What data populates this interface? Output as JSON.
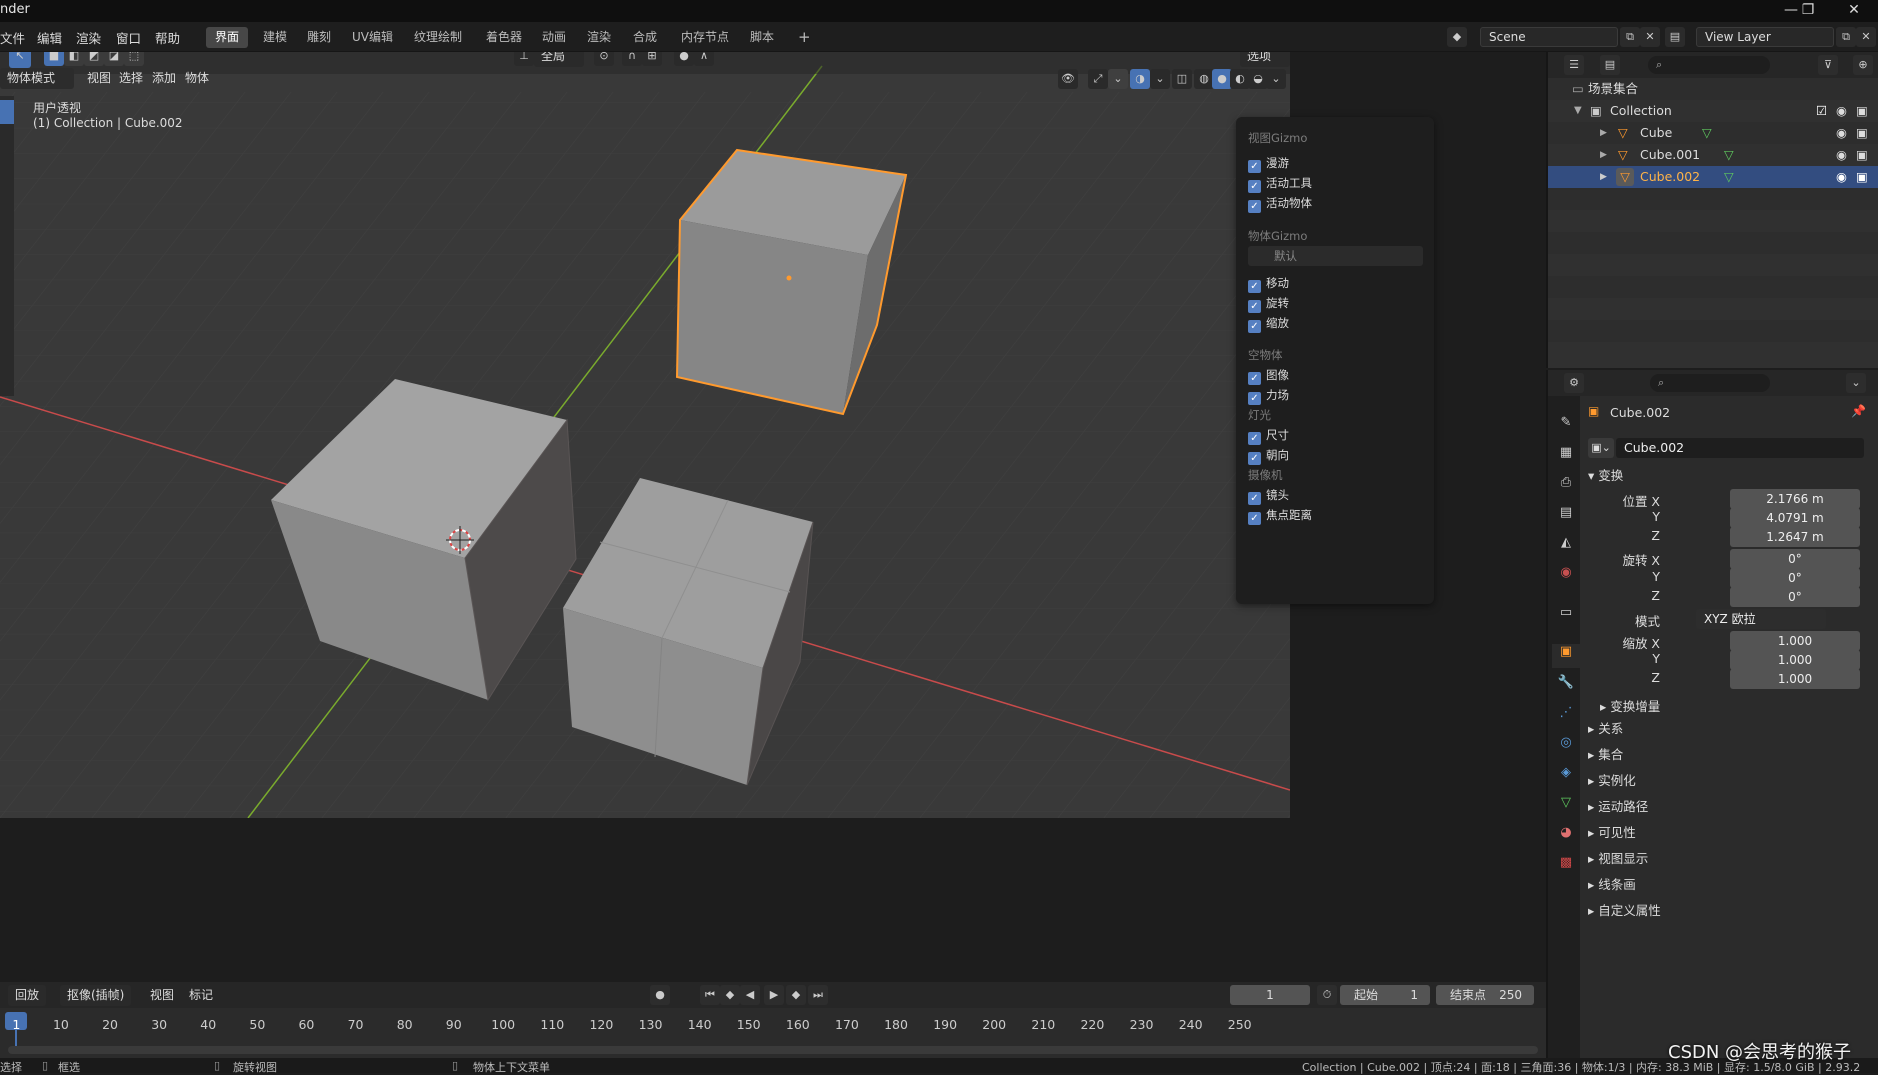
{
  "titlebar": {
    "title": "nder",
    "min_icon": "—",
    "max_icon": "❐",
    "close_icon": "✕"
  },
  "menubar": [
    "文件",
    "编辑",
    "渲染",
    "窗口",
    "帮助"
  ],
  "workspaces": [
    "界面",
    "建模",
    "雕刻",
    "UV编辑",
    "纹理绘制",
    "着色器",
    "动画",
    "渲染",
    "合成",
    "内存节点",
    "脚本"
  ],
  "add_workspace": "+",
  "scene_field": "Scene",
  "view_layer_field": "View Layer",
  "tool_header": {
    "transform_orient": "全局",
    "options": "选项 ⌄"
  },
  "viewport_header": {
    "mode": "物体模式",
    "menus": [
      "视图",
      "选择",
      "添加",
      "物体"
    ]
  },
  "viewport_overlay": {
    "line1": "用户透视",
    "line2": "(1) Collection | Cube.002"
  },
  "gizmo_popup": {
    "sections": [
      {
        "title": "视图Gizmo",
        "items": [
          "漫游",
          "活动工具",
          "活动物体"
        ]
      },
      {
        "title": "物体Gizmo",
        "dropdown": "默认",
        "items": [
          "移动",
          "旋转",
          "缩放"
        ]
      },
      {
        "title": "空物体",
        "items": [
          "图像",
          "力场"
        ]
      },
      {
        "title": "灯光",
        "items": [
          "尺寸",
          "朝向"
        ]
      },
      {
        "title": "摄像机",
        "items": [
          "镜头",
          "焦点距离"
        ]
      }
    ]
  },
  "outliner": {
    "root": "场景集合",
    "collection": "Collection",
    "objects": [
      "Cube",
      "Cube.001",
      "Cube.002"
    ],
    "selected": "Cube.002"
  },
  "properties": {
    "object_name": "Cube.002",
    "name_field": "Cube.002",
    "panel": "变换",
    "location": {
      "label": "位置 X",
      "x": "2.1766 m",
      "y": "4.0791 m",
      "z": "1.2647 m"
    },
    "rotation": {
      "label": "旋转 X",
      "x": "0°",
      "y": "0°",
      "z": "0°"
    },
    "mode_label": "模式",
    "mode_value": "XYZ 欧拉",
    "scale": {
      "label": "缩放 X",
      "x": "1.000",
      "y": "1.000",
      "z": "1.000"
    },
    "axis_y": "Y",
    "axis_z": "Z",
    "delta": "变换增量",
    "sections": [
      "关系",
      "集合",
      "实例化",
      "运动路径",
      "可见性",
      "视图显示",
      "线条画",
      "自定义属性"
    ]
  },
  "timeline": {
    "playback": "回放",
    "keying": "抠像(插帧)",
    "view": "视图",
    "marker": "标记",
    "current_frame": "1",
    "start_label": "起始",
    "start": "1",
    "end_label": "结束点",
    "end": "250",
    "ticks": [
      "1",
      "10",
      "20",
      "30",
      "40",
      "50",
      "60",
      "70",
      "80",
      "90",
      "100",
      "110",
      "120",
      "130",
      "140",
      "150",
      "160",
      "170",
      "180",
      "190",
      "200",
      "210",
      "220",
      "230",
      "240",
      "250"
    ]
  },
  "statusbar": {
    "select": "选择",
    "box": "框选",
    "rotate": "旋转视图",
    "context": "物体上下文菜单",
    "stats": "Collection | Cube.002 | 顶点:24 | 面:18 | 三角面:36 | 物体:1/3 | 内存: 38.3 MiB | 显存: 1.5/8.0 GiB | 2.93.2"
  },
  "watermark": "CSDN @会思考的猴子",
  "colors": {
    "accent": "#4772b3",
    "selection": "#ff9a2e",
    "x_axis": "#c84b4b",
    "y_axis": "#7aab2d"
  }
}
